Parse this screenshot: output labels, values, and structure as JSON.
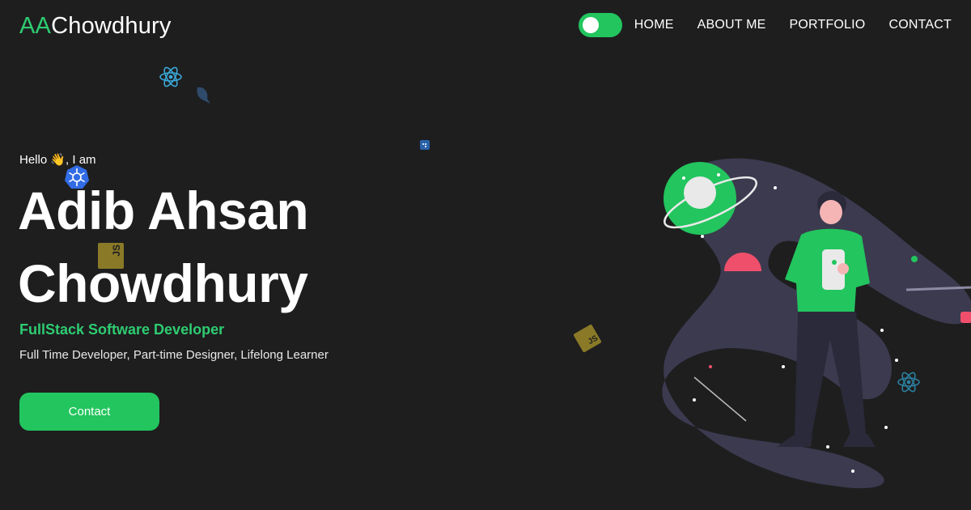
{
  "header": {
    "logo_initials": "AA",
    "logo_name": "Chowdhury",
    "theme_toggle_state": "on",
    "nav": [
      {
        "label": "HOME"
      },
      {
        "label": "ABOUT ME"
      },
      {
        "label": "PORTFOLIO"
      },
      {
        "label": "CONTACT"
      }
    ]
  },
  "hero": {
    "greeting": "Hello 👋, I am",
    "name_line1": "Adib Ahsan",
    "name_line2": "Chowdhury",
    "role": "FullStack Software Developer",
    "tagline": "Full Time Developer, Part-time Designer, Lifelong Learner",
    "cta_label": "Contact"
  },
  "floating_icons": {
    "js_label": "JS"
  },
  "colors": {
    "accent": "#22c55e",
    "background": "#1e1e1f",
    "illustration_path": "#3c3a4f",
    "highlight_pink": "#f04f6b"
  },
  "icons": [
    "react-icon",
    "kubernetes-icon",
    "javascript-icon",
    "docker-icon",
    "bird-icon",
    "astronaut-illustration"
  ]
}
